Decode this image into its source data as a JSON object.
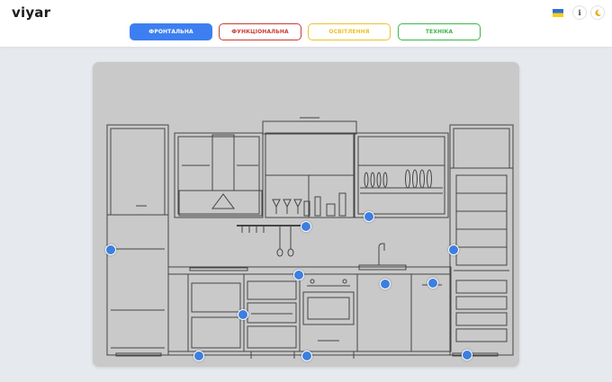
{
  "header": {
    "logo": "viyar",
    "info_label": "i",
    "tabs": [
      {
        "label": "ФРОНТАЛЬНА",
        "color": "#3d7ff0",
        "active": true
      },
      {
        "label": "ФУНКЦІОНАЛЬНА",
        "color": "#c93b35",
        "active": false
      },
      {
        "label": "ОСВІТЛЕННЯ",
        "color": "#e9c32a",
        "active": false
      },
      {
        "label": "ТЕХНІКА",
        "color": "#3cb64b",
        "active": false
      }
    ],
    "icons": [
      "flag-ukraine-icon",
      "info-icon",
      "moon-icon"
    ]
  },
  "colors": {
    "accent": "#3d7ff0",
    "hotspot": "#3c7fe0",
    "stage_bg": "#c9c9c9",
    "line": "#454545"
  },
  "hotspots_count": 12
}
